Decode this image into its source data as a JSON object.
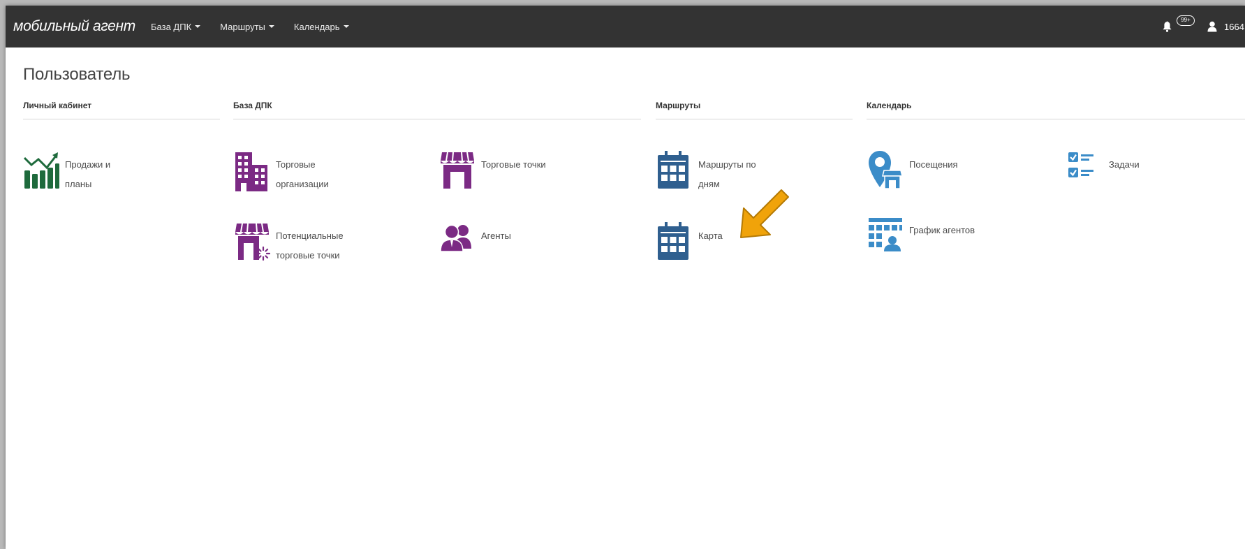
{
  "navbar": {
    "brand": "мобильный агент",
    "menu": [
      {
        "label": "База ДПК"
      },
      {
        "label": "Маршруты"
      },
      {
        "label": "Календарь"
      }
    ],
    "notification_badge": "99+",
    "user_id": "1664"
  },
  "page": {
    "title": "Пользователь"
  },
  "sections": {
    "personal": "Личный кабинет",
    "base": "База ДПК",
    "routes": "Маршруты",
    "calendar": "Календарь"
  },
  "tiles": {
    "sales_plans": {
      "label": "Продажи и\nпланы",
      "icon": "chart-bars-icon",
      "color": "#1e6a3c"
    },
    "trade_orgs": {
      "label": "Торговые\nорганизации",
      "icon": "building-icon",
      "color": "#7b2a84"
    },
    "trade_points": {
      "label": "Торговые точки",
      "icon": "storefront-icon",
      "color": "#7b2a84"
    },
    "potential_points": {
      "label": "Потенциальные\nторговые точки",
      "icon": "storefront-loading-icon",
      "color": "#7b2a84"
    },
    "agents": {
      "label": "Агенты",
      "icon": "agents-icon",
      "color": "#7b2a84"
    },
    "routes_by_day": {
      "label": "Маршруты по\nдням",
      "icon": "calendar-icon",
      "color": "#2f5f8f"
    },
    "map": {
      "label": "Карта",
      "icon": "calendar-icon",
      "color": "#2f5f8f"
    },
    "visits": {
      "label": "Посещения",
      "icon": "map-pin-store-icon",
      "color": "#3b8cc8"
    },
    "tasks": {
      "label": "Задачи",
      "icon": "checklist-icon",
      "color": "#3b8cc8"
    },
    "agent_schedule": {
      "label": "График агентов",
      "icon": "schedule-agent-icon",
      "color": "#3b8cc8"
    }
  },
  "annotation": {
    "icon": "pointer-arrow-icon",
    "color": "#f0a30a"
  }
}
